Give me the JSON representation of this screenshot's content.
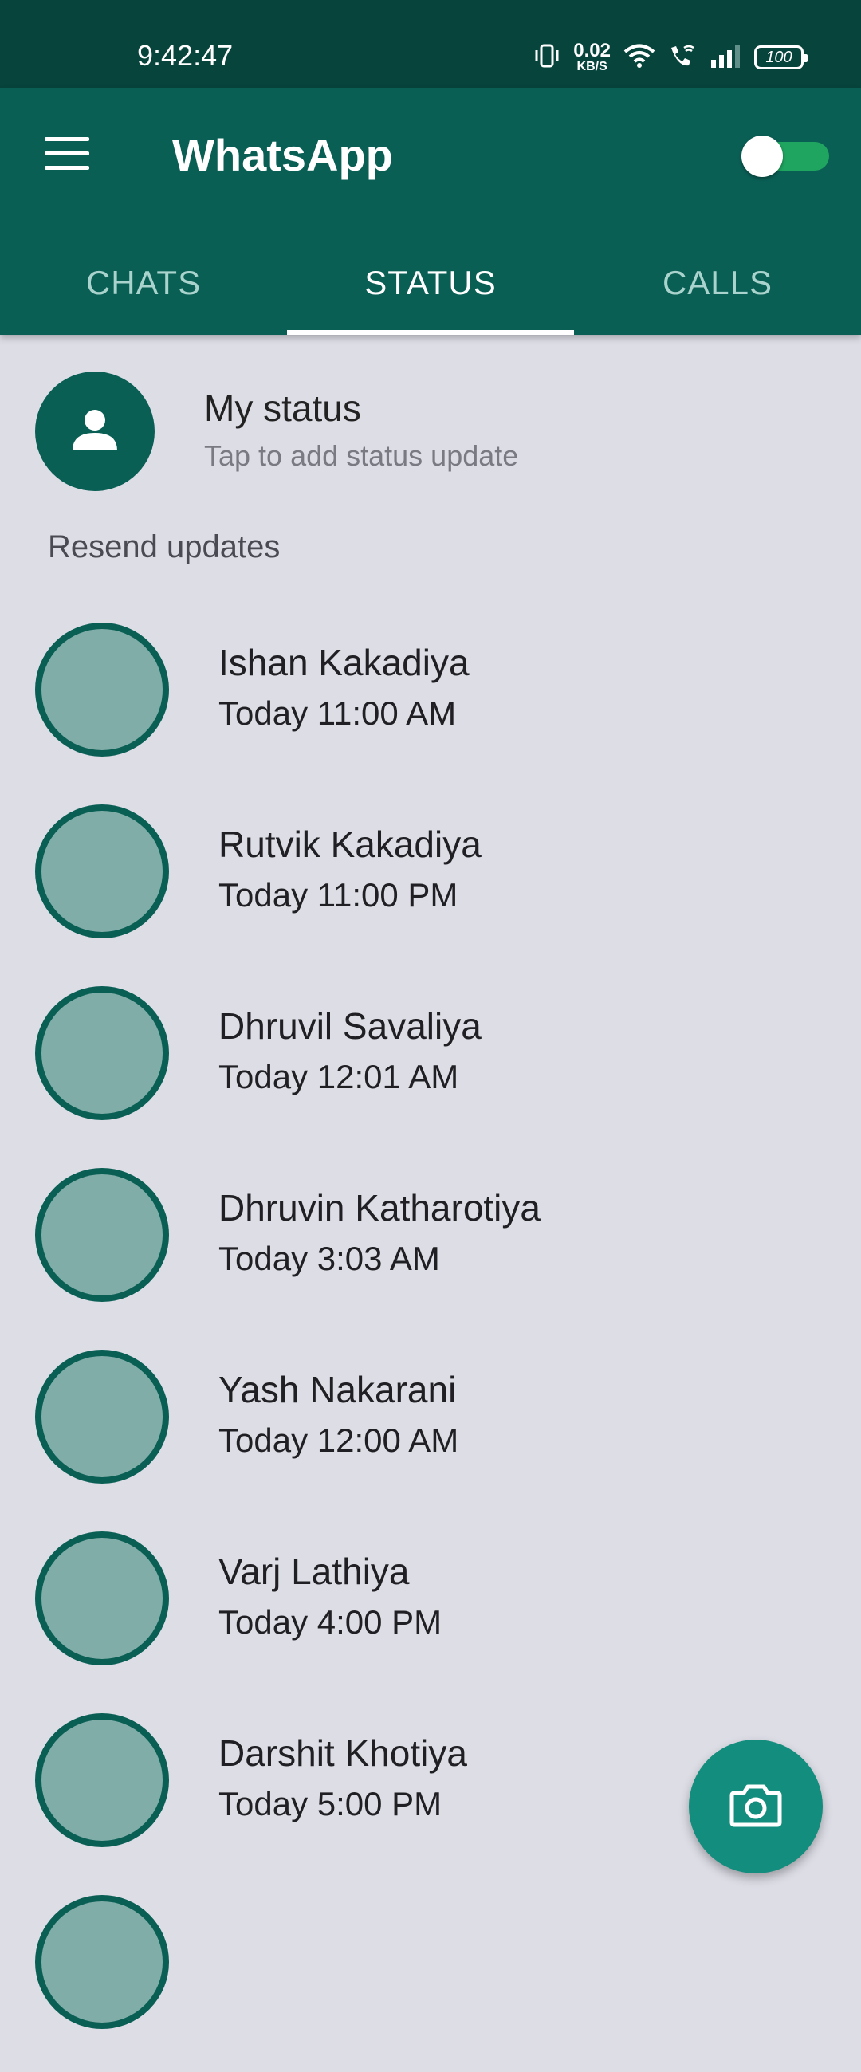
{
  "status_bar": {
    "time": "9:42:47",
    "net_speed_value": "0.02",
    "net_speed_unit": "KB/S",
    "battery": "100"
  },
  "app_bar": {
    "title": "WhatsApp",
    "theme_toggle_on": true,
    "accent_color": "#0a5f55",
    "toggle_color": "#1fa55f"
  },
  "tabs": [
    {
      "label": "CHATS",
      "active": false
    },
    {
      "label": "STATUS",
      "active": true
    },
    {
      "label": "CALLS",
      "active": false
    }
  ],
  "my_status": {
    "title": "My status",
    "subtitle": "Tap to add status update",
    "icon": "person-icon"
  },
  "section_label": "Resend updates",
  "updates": [
    {
      "name": "Ishan Kakadiya",
      "time": "Today 11:00 AM"
    },
    {
      "name": "Rutvik Kakadiya",
      "time": "Today 11:00 PM"
    },
    {
      "name": "Dhruvil Savaliya",
      "time": "Today 12:01 AM"
    },
    {
      "name": "Dhruvin Katharotiya",
      "time": "Today 3:03 AM"
    },
    {
      "name": "Yash Nakarani",
      "time": "Today 12:00 AM"
    },
    {
      "name": "Varj Lathiya",
      "time": "Today 4:00 PM"
    },
    {
      "name": "Darshit Khotiya",
      "time": "Today 5:00 PM"
    }
  ],
  "fab": {
    "icon": "camera-icon",
    "color": "#138d7d"
  }
}
